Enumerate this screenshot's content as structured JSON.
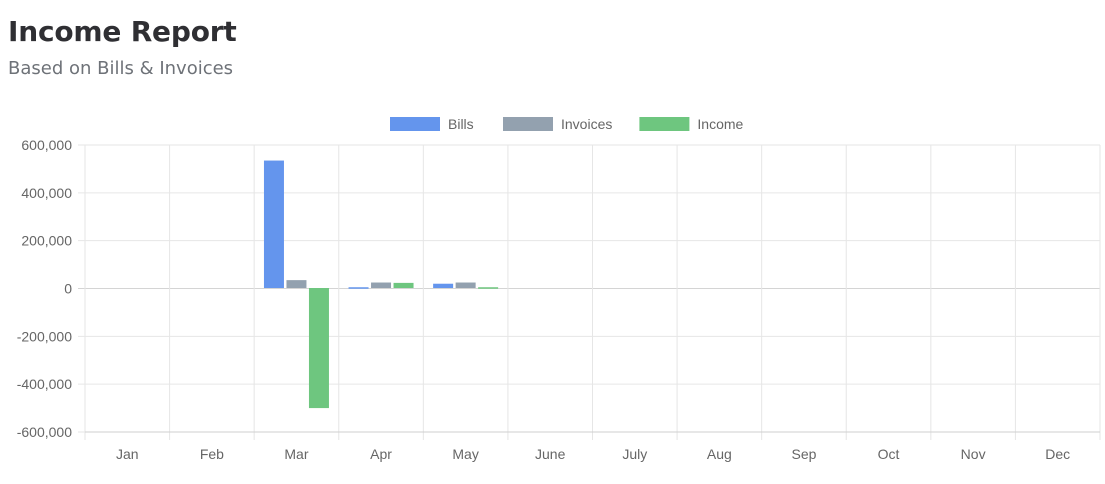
{
  "page": {
    "title": "Income Report",
    "subtitle": "Based on Bills & Invoices"
  },
  "chart_data": {
    "type": "bar",
    "categories": [
      "Jan",
      "Feb",
      "Mar",
      "Apr",
      "May",
      "June",
      "July",
      "Aug",
      "Sep",
      "Oct",
      "Nov",
      "Dec"
    ],
    "series": [
      {
        "name": "Bills",
        "color": "#6495ED",
        "values": [
          0,
          0,
          535000,
          1500,
          20000,
          0,
          0,
          0,
          0,
          0,
          0,
          0
        ]
      },
      {
        "name": "Invoices",
        "color": "#93A1AF",
        "values": [
          0,
          0,
          35000,
          25000,
          25000,
          0,
          0,
          0,
          0,
          0,
          0,
          0
        ]
      },
      {
        "name": "Income",
        "color": "#6EC67F",
        "values": [
          0,
          0,
          -500000,
          23500,
          5000,
          0,
          0,
          0,
          0,
          0,
          0,
          0
        ]
      }
    ],
    "yticks": [
      "600,000",
      "400,000",
      "200,000",
      "0",
      "-200,000",
      "-400,000",
      "-600,000"
    ],
    "ylim": [
      -600000,
      600000
    ],
    "grid": true,
    "legend": "top-center"
  }
}
